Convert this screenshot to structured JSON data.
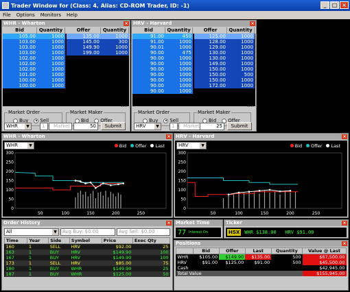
{
  "window": {
    "title": "Trader Window for  (Class: 4, Alias: CD-ROM Trader, ID: -1)"
  },
  "menu": [
    "File",
    "Options",
    "Monitors",
    "Help"
  ],
  "colors": {
    "bid": "#ff2020",
    "offer": "#20c0c0",
    "last": "#ffffff",
    "titlebar": "#0a3fa8"
  },
  "books": [
    {
      "title": "WHR - Wharton",
      "headers": [
        "Bid",
        "Quantity",
        "Offer",
        "Quantity"
      ],
      "bids": [
        [
          "105.00",
          "1000"
        ],
        [
          "103.00",
          "1000"
        ],
        [
          "103.00",
          "1000"
        ],
        [
          "103.00",
          "1000"
        ],
        [
          "102.00",
          "1000"
        ],
        [
          "102.00",
          "1000"
        ],
        [
          "102.00",
          "1000"
        ],
        [
          "101.00",
          "1000"
        ],
        [
          "100.00",
          "1000"
        ],
        [
          "100.00",
          "1000"
        ]
      ],
      "offers": [
        [
          "135.00",
          "1000"
        ],
        [
          "145.00",
          "300"
        ],
        [
          "149.90",
          "1000"
        ],
        [
          "199.00",
          "1000"
        ]
      ],
      "market_order_label": "Market Order",
      "market_maker_label": "Market Maker",
      "buy_label": "Buy",
      "sell_label": "Sell",
      "bid_label": "Bid",
      "offer_label": "Offer",
      "symbol": "WHR",
      "qty_placeholder": "1",
      "type_placeholder": "Market",
      "quantity": "50",
      "submit_label": "Submit",
      "collapse_label": "^^"
    },
    {
      "title": "HRV - Harvard",
      "headers": [
        "Bid",
        "Quantity",
        "Offer",
        "Quantity"
      ],
      "bids": [
        [
          "91.00",
          "450"
        ],
        [
          "91.00",
          "1000"
        ],
        [
          "90.01",
          "1000"
        ],
        [
          "90.00",
          "475"
        ],
        [
          "90.00",
          "1000"
        ],
        [
          "90.00",
          "1000"
        ],
        [
          "90.00",
          "1000"
        ],
        [
          "90.00",
          "1000"
        ],
        [
          "90.00",
          "1000"
        ],
        [
          "90.00",
          "1000"
        ],
        [
          "90.00",
          "1000"
        ]
      ],
      "offers": [
        [
          "125.00",
          "1000"
        ],
        [
          "128.00",
          "1000"
        ],
        [
          "129.00",
          "1000"
        ],
        [
          "130.00",
          "1000"
        ],
        [
          "130.00",
          "1000"
        ],
        [
          "149.00",
          "1000"
        ],
        [
          "150.00",
          "1000"
        ],
        [
          "150.00",
          "500"
        ],
        [
          "150.00",
          "1000"
        ],
        [
          "172.00",
          "1000"
        ]
      ],
      "market_order_label": "Market Order",
      "market_maker_label": "Market Maker",
      "buy_label": "Buy",
      "sell_label": "Sell",
      "bid_label": "Bid",
      "offer_label": "Offer",
      "symbol": "HRV",
      "qty_placeholder": "1",
      "type_placeholder": "Market",
      "quantity": "25",
      "submit_label": "Submit",
      "collapse_label": "^^"
    }
  ],
  "charts": [
    {
      "title": "WHR - Wharton",
      "symbol": "WHR",
      "legend": [
        "Bid",
        "Offer",
        "Last"
      ],
      "chart_data": {
        "type": "line",
        "yticks": [
          "300",
          "250",
          "200",
          "150",
          "100",
          "50",
          "0"
        ],
        "xticks": [
          "50",
          "100",
          "150",
          "200",
          "250"
        ],
        "ylim": [
          0,
          300
        ],
        "xlim": [
          0,
          300
        ],
        "series": [
          {
            "name": "Offer",
            "points": [
              [
                0,
                195
              ],
              [
                40,
                190
              ],
              [
                40,
                175
              ],
              [
                75,
                175
              ],
              [
                75,
                150
              ],
              [
                130,
                150
              ],
              [
                130,
                140
              ],
              [
                215,
                140
              ]
            ]
          },
          {
            "name": "Bid",
            "points": [
              [
                0,
                110
              ],
              [
                75,
                110
              ],
              [
                75,
                100
              ],
              [
                110,
                100
              ],
              [
                110,
                120
              ],
              [
                170,
                120
              ],
              [
                170,
                135
              ],
              [
                215,
                135
              ]
            ]
          },
          {
            "name": "Last",
            "points": [
              [
                120,
                150
              ],
              [
                130,
                145
              ],
              [
                140,
                135
              ],
              [
                150,
                140
              ],
              [
                160,
                110
              ],
              [
                175,
                135
              ],
              [
                190,
                125
              ],
              [
                205,
                130
              ],
              [
                215,
                135
              ]
            ]
          }
        ],
        "volume_bars": [
          [
            120,
            60
          ],
          [
            125,
            85
          ],
          [
            130,
            95
          ],
          [
            135,
            75
          ],
          [
            140,
            90
          ],
          [
            145,
            65
          ],
          [
            150,
            80
          ],
          [
            155,
            95
          ],
          [
            160,
            55
          ],
          [
            165,
            85
          ],
          [
            170,
            90
          ],
          [
            175,
            70
          ],
          [
            180,
            95
          ],
          [
            185,
            60
          ],
          [
            190,
            90
          ],
          [
            195,
            80
          ],
          [
            200,
            65
          ],
          [
            205,
            85
          ],
          [
            210,
            75
          ]
        ]
      }
    },
    {
      "title": "HRV - Harvard",
      "symbol": "HRV",
      "legend": [
        "Bid",
        "Offer",
        "Last"
      ],
      "chart_data": {
        "type": "line",
        "yticks": [
          "300",
          "250",
          "200",
          "150",
          "100",
          "50",
          "0"
        ],
        "xticks": [
          "50",
          "100",
          "150",
          "200",
          "250"
        ],
        "ylim": [
          0,
          300
        ],
        "xlim": [
          0,
          300
        ],
        "series": [
          {
            "name": "Offer",
            "points": [
              [
                0,
                165
              ],
              [
                70,
                165
              ],
              [
                70,
                150
              ],
              [
                120,
                150
              ],
              [
                120,
                140
              ],
              [
                160,
                140
              ],
              [
                160,
                130
              ],
              [
                215,
                130
              ]
            ]
          },
          {
            "name": "Bid",
            "points": [
              [
                0,
                140
              ],
              [
                15,
                140
              ],
              [
                15,
                65
              ],
              [
                40,
                65
              ],
              [
                40,
                75
              ],
              [
                90,
                75
              ],
              [
                90,
                80
              ],
              [
                130,
                80
              ],
              [
                130,
                90
              ],
              [
                215,
                90
              ]
            ]
          },
          {
            "name": "Last",
            "points": [
              [
                80,
                75
              ],
              [
                100,
                85
              ],
              [
                120,
                90
              ],
              [
                140,
                95
              ],
              [
                160,
                100
              ],
              [
                180,
                92
              ],
              [
                200,
                95
              ]
            ]
          }
        ],
        "volume_bars": [
          [
            70,
            55
          ],
          [
            80,
            70
          ],
          [
            90,
            80
          ],
          [
            100,
            90
          ],
          [
            110,
            85
          ],
          [
            120,
            95
          ],
          [
            130,
            90
          ],
          [
            140,
            80
          ],
          [
            150,
            95
          ],
          [
            160,
            85
          ],
          [
            170,
            90
          ],
          [
            180,
            75
          ],
          [
            190,
            95
          ],
          [
            200,
            85
          ],
          [
            210,
            90
          ]
        ]
      }
    }
  ],
  "order_history": {
    "title": "Order History",
    "filter": "All",
    "avg_buy": "Avg Buy: $0.00",
    "avg_sell": "Avg Sell: $0.00",
    "headers": [
      "Time",
      "Year",
      "Side",
      "Symbol",
      "Price",
      "Exec Qty"
    ],
    "rows": [
      [
        "160",
        "1",
        "SELL",
        "HRV",
        "$92.00",
        "25"
      ],
      [
        "163",
        "1",
        "BUY",
        "HRV",
        "$149.90",
        "100"
      ],
      [
        "167",
        "1",
        "BUY",
        "HRV",
        "$149.90",
        "100"
      ],
      [
        "173",
        "1",
        "SELL",
        "HRV",
        "$85.00",
        "75"
      ],
      [
        "180",
        "1",
        "BUY",
        "WHR",
        "$149.90",
        "25"
      ],
      [
        "187",
        "1",
        "BUY",
        "WHR",
        "$125.00",
        "50"
      ]
    ]
  },
  "market_time": {
    "title": "Market Time",
    "value": "77",
    "status": "Interest On"
  },
  "ticker": {
    "title": "Ticker",
    "badge": "HSX",
    "text": "WHR $138.00   HRV $91.00"
  },
  "positions": {
    "title": "Positions",
    "headers": [
      "",
      "Bid",
      "Offer",
      "Last",
      "Quantity",
      "Value @ Last"
    ],
    "rows": [
      [
        "WHR",
        "$105.00",
        "$149.90",
        "$135.00",
        "500",
        "$67,500.00"
      ],
      [
        "HRV",
        "$91.00",
        "$125.00",
        "$91.00",
        "500",
        "$45,500.00"
      ],
      [
        "Cash",
        "",
        "",
        "",
        "",
        "$42,945.00"
      ]
    ],
    "total_label": "Total Value",
    "total_value": "$155,945.00"
  }
}
